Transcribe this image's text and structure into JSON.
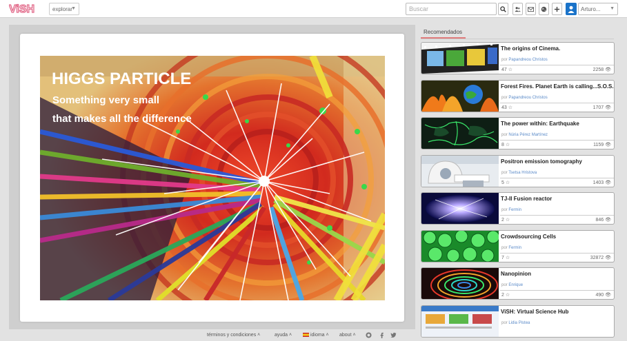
{
  "header": {
    "logo_text": "ViSH",
    "explore_label": "explorar",
    "search_placeholder": "Buscar",
    "user_name": "Arturo..."
  },
  "slide": {
    "title": "HIGGS PARTICLE",
    "subtitle_line1": "Something very small",
    "subtitle_line2": "that makes all the difference"
  },
  "sidebar": {
    "tab_label": "Recomendados",
    "by_label": "por",
    "items": [
      {
        "title": "The origins of Cinema.",
        "author": "Papandreou Christos",
        "stars": "47",
        "views": "2258"
      },
      {
        "title": "Forest Fires. Planet Earth is calling...S.O.S.",
        "author": "Papandreou Christos",
        "stars": "43",
        "views": "1707"
      },
      {
        "title": "The power within: Earthquake",
        "author": "Núria Pérez Martínez",
        "stars": "8",
        "views": "1159"
      },
      {
        "title": "Positron emission tomography",
        "author": "Tsetsa Hristova",
        "stars": "5",
        "views": "1403"
      },
      {
        "title": "TJ-II Fusion reactor",
        "author": "Fermin",
        "stars": "2",
        "views": "846"
      },
      {
        "title": "Crowdsourcing Cells",
        "author": "Fermin",
        "stars": "7",
        "views": "32872"
      },
      {
        "title": "Nanopinion",
        "author": "Enrique",
        "stars": "2",
        "views": "490"
      },
      {
        "title": "ViSH: Virtual Science Hub",
        "author": "Lidia Pistea",
        "stars": "",
        "views": ""
      }
    ]
  },
  "footer": {
    "terms": "términos y condiciones",
    "help": "ayuda",
    "language": "idioma",
    "about": "about"
  }
}
